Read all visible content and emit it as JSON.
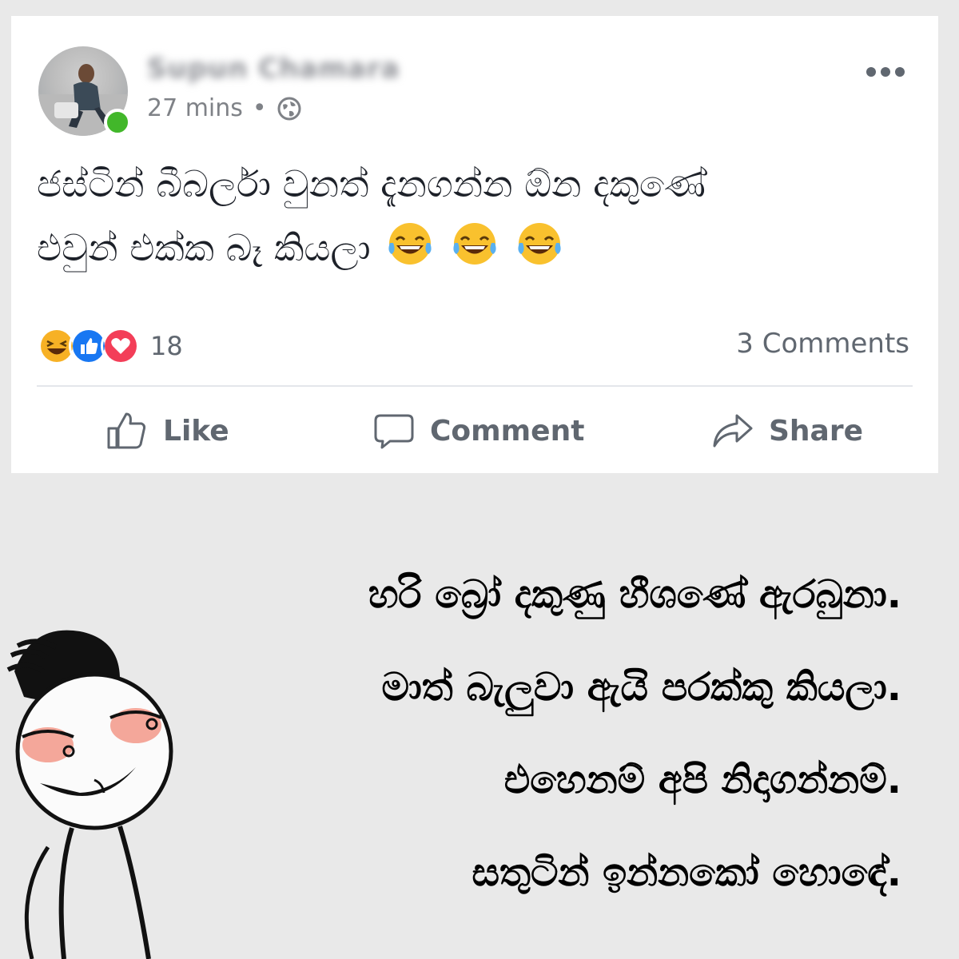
{
  "post": {
    "author": "Supun Chamara",
    "time": "27 mins",
    "separator": "•",
    "text_line1": "ජස්ටින් බීබර්ලා වුනත් දැනගන්න ඕන දකුණේ",
    "text_line2": "එවුන් එක්ක බෑ කියලා",
    "reaction_count": "18",
    "comments_count": "3 Comments"
  },
  "actions": {
    "like": "Like",
    "comment": "Comment",
    "share": "Share"
  },
  "dialogue": {
    "line1": "හරි බ්‍රෝ දකුණු හීශණේ ඇරබුනා.",
    "line2": "මාත් බැලුවා ඇයි පරක්කු කියලා.",
    "line3": "එහෙනම් අපි නිදාගන්නම්.",
    "line4": "සතුටින් ඉන්නකෝ හොඳේ."
  },
  "colors": {
    "online": "#42b72a",
    "like_blue": "#1877f2",
    "love_red": "#f33e58",
    "haha_yellow": "#f7b125",
    "text_gray": "#606770"
  },
  "icons": [
    "globe-icon",
    "more-icon",
    "laugh-emoji-icon",
    "haha-reaction-icon",
    "like-reaction-icon",
    "love-reaction-icon",
    "thumbs-up-icon",
    "comment-icon",
    "share-icon"
  ]
}
